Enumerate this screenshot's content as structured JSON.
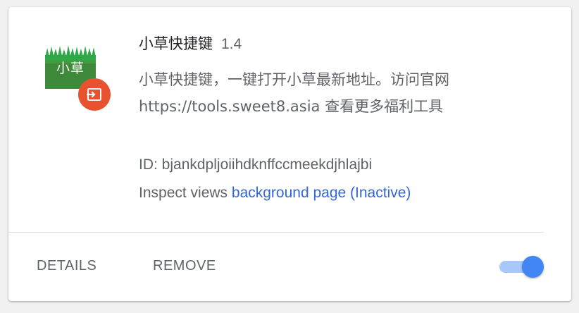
{
  "extension": {
    "name": "小草快捷键",
    "version": "1.4",
    "description_lines": [
      "小草快捷键，一键打开小草最新地址。访问官网",
      "https://tools.sweet8.asia 查看更多福利工具"
    ],
    "id_label": "ID: ",
    "id_value": "bjankdpljoiihdknffccmeekdjhlajbi",
    "inspect_label": "Inspect views ",
    "inspect_link": "background page (Inactive)",
    "logo_text": "小草",
    "badge_icon": "input-arrow-icon",
    "enabled": true
  },
  "actions": {
    "details_label": "DETAILS",
    "remove_label": "REMOVE"
  },
  "colors": {
    "logo_green": "#3e8a3a",
    "grass_green": "#2fa84a",
    "badge_orange": "#e8522f",
    "toggle_knob": "#4285f4",
    "toggle_track": "#a8c7fa",
    "link_blue": "#3367d6"
  }
}
